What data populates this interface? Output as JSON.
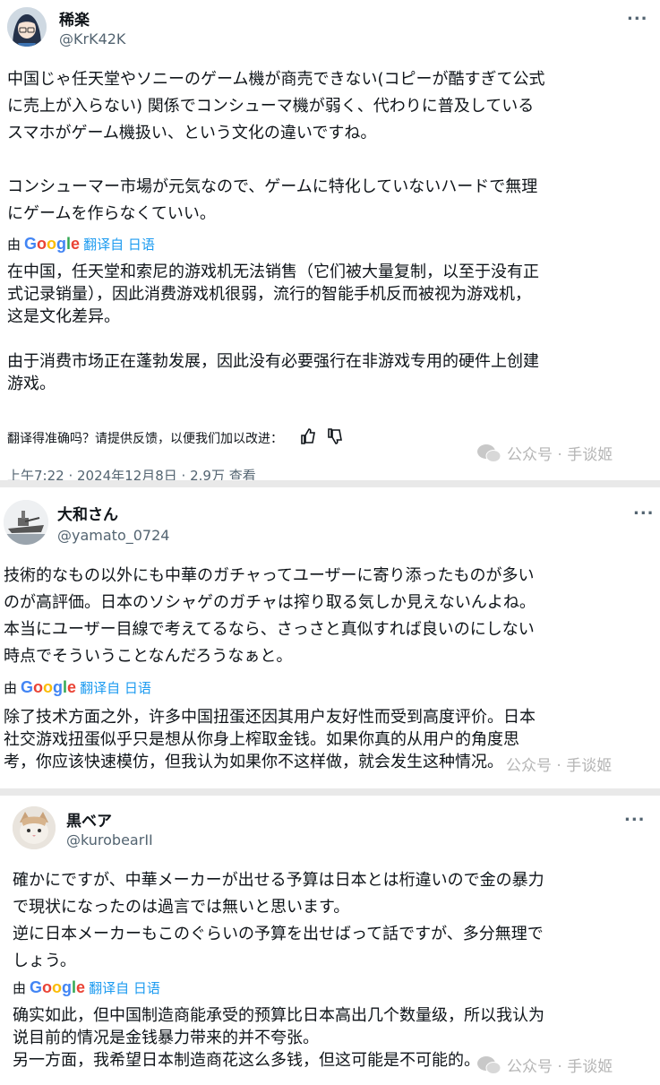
{
  "colors": {
    "accent": "#1d9bf0",
    "text": "#0f1419",
    "muted": "#536471"
  },
  "google_wordmark": [
    "G",
    "o",
    "o",
    "g",
    "l",
    "e"
  ],
  "tweets": [
    {
      "author": "稀楽",
      "handle": "@KrK42K",
      "more": "...",
      "original": "中国じゃ任天堂やソニーのゲーム機が商売できない(コピーが酷すぎて公式\nに売上が入らない) 関係でコンシューマ機が弱く、代わりに普及している\nスマホがゲーム機扱い、という文化の違いですね。\n\nコンシューマー市場が元気なので、ゲームに特化していないハードで無理\nにゲームを作らなくていい。",
      "by": "由",
      "translated_from": "翻译自 日语",
      "translation": "在中国，任天堂和索尼的游戏机无法销售（它们被大量复制，以至于没有正\n式记录销量），因此消费游戏机很弱，流行的智能手机反而被视为游戏机，\n这是文化差异。\n\n由于消费市场正在蓬勃发展，因此没有必要强行在非游戏专用的硬件上创建\n游戏。",
      "feedback": "翻译得准确吗？请提供反馈，以便我们加以改进：",
      "meta": "上午7:22 · 2024年12月8日 · 2.9万 查看"
    },
    {
      "author": "大和さん",
      "handle": "@yamato_0724",
      "more": "...",
      "original": "技術的なもの以外にも中華のガチャってユーザーに寄り添ったものが多い\nのが高評価。日本のソシャゲのガチャは搾り取る気しか見えないんよね。\n本当にユーザー目線で考えてるなら、さっさと真似すれば良いのにしない\n時点でそういうことなんだろうなぁと。",
      "by": "由",
      "translated_from": "翻译自 日语",
      "translation": "除了技术方面之外，许多中国扭蛋还因其用户友好性而受到高度评价。日本\n社交游戏扭蛋似乎只是想从你身上榨取金钱。如果你真的从用户的角度思\n考，你应该快速模仿，但我认为如果你不这样做，就会发生这种情况。"
    },
    {
      "author": "黒ベア",
      "handle": "@kurobearII",
      "more": "...",
      "original": "確かにですが、中華メーカーが出せる予算は日本とは桁違いので金の暴力\nで現状になったのは過言では無いと思います。\n逆に日本メーカーもこのぐらいの予算を出せばって話ですが、多分無理で\nしょう。",
      "by": "由",
      "translated_from": "翻译自 日语",
      "translation": "确实如此，但中国制造商能承受的预算比日本高出几个数量级，所以我认为\n说目前的情况是金钱暴力带来的并不夸张。\n另一方面，我希望日本制造商花这么多钱，但这可能是不可能的。"
    }
  ],
  "watermark": "公众号 · 手谈姬"
}
